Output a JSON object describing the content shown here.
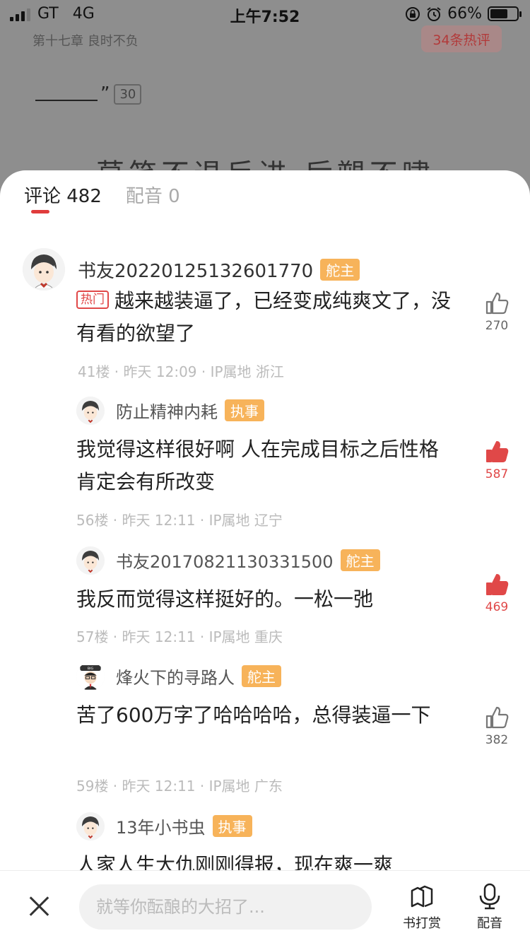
{
  "status_bar": {
    "carrier": "GT",
    "network": "4G",
    "time": "上午7:52",
    "battery": "66%",
    "battery_level": 0.66
  },
  "reader": {
    "chapter_title": "第十七章 良时不负",
    "hot_comments_pill": "34条热评",
    "line_end": "”",
    "paragraph_comment_count": "30",
    "partial_text": "莫笑不退反进 后塑不啸"
  },
  "tabs": [
    {
      "label": "评论 482",
      "active": true
    },
    {
      "label": "配音 0",
      "active": false
    }
  ],
  "comments": [
    {
      "username": "书友20220125132601770",
      "badge": "舵主",
      "hot_tag": "热门",
      "text": "越来越装逼了，已经变成纯爽文了，没有看的欲望了",
      "meta": "41楼 · 昨天 12:09 · IP属地 浙江",
      "likes": "270",
      "liked": false
    },
    {
      "username": "防止精神内耗",
      "badge": "执事",
      "text": "我觉得这样很好啊 人在完成目标之后性格肯定会有所改变",
      "meta": "56楼 · 昨天 12:11 · IP属地 辽宁",
      "likes": "587",
      "liked": true
    },
    {
      "username": "书友20170821130331500",
      "badge": "舵主",
      "text": "我反而觉得这样挺好的。一松一弛",
      "meta": "57楼 · 昨天 12:11 · IP属地 重庆",
      "likes": "469",
      "liked": true
    },
    {
      "username": "烽火下的寻路人",
      "badge": "舵主",
      "text": "苦了600万字了哈哈哈哈，总得装逼一下",
      "meta": "59楼 · 昨天 12:11 · IP属地 广东",
      "likes": "382",
      "liked": false
    },
    {
      "username": "13年小书虫",
      "badge": "执事",
      "text": "人家人生大仇刚刚得报，现在爽一爽",
      "meta": "",
      "likes": "",
      "liked": false
    }
  ],
  "bottom_bar": {
    "input_placeholder": "就等你酝酿的大招了...",
    "reward_label": "书打赏",
    "dub_label": "配音"
  },
  "colors": {
    "accent_red": "#e04848",
    "badge_orange": "#f7b35a"
  }
}
